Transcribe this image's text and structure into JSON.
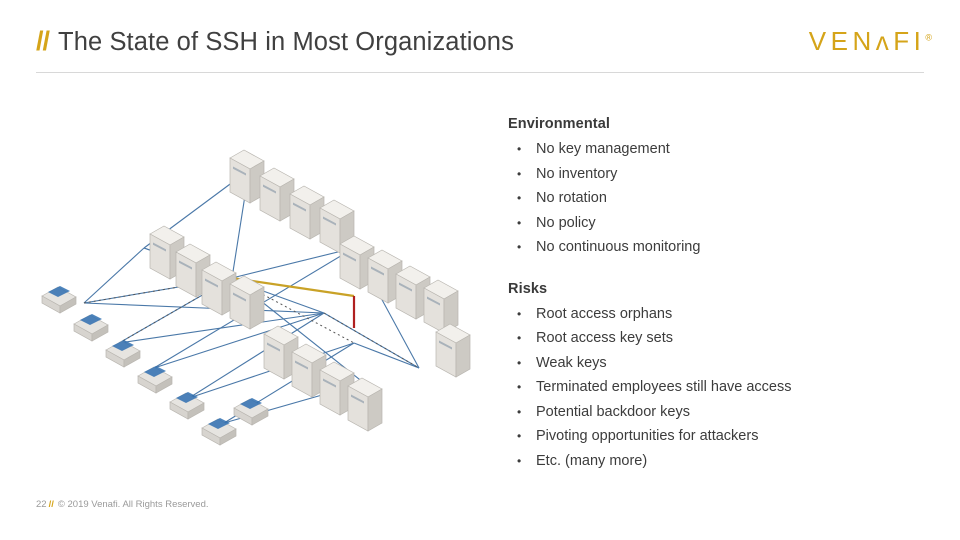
{
  "header": {
    "slashes": "//",
    "title": "The State of SSH in Most Organizations",
    "logo_text": "VENʌFI",
    "logo_reg": "®"
  },
  "content": {
    "groups": [
      {
        "heading": "Environmental",
        "items": [
          "No key management",
          "No inventory",
          "No rotation",
          "No policy",
          "No continuous monitoring"
        ]
      },
      {
        "heading": "Risks",
        "items": [
          "Root access orphans",
          "Root access key sets",
          "Weak keys",
          "Terminated employees still have access",
          "Potential backdoor keys",
          "Pivoting opportunities for attackers",
          "Etc. (many more)"
        ]
      }
    ]
  },
  "footer": {
    "page_number": "22",
    "slashes": "//",
    "copyright": "© 2019 Venafi. All Rights Reserved."
  },
  "diagram": {
    "alt": "isometric network diagram of servers and workstations connected by lines",
    "colors": {
      "accent": "#d5a419",
      "line_blue": "#4a78a8",
      "line_gold": "#c9a227",
      "line_red": "#b02020",
      "server_body": "#e8e6e2",
      "server_shade": "#c9c6c0",
      "workstation_body": "#dedcd8",
      "screen_blue": "#2f6fb0"
    }
  }
}
